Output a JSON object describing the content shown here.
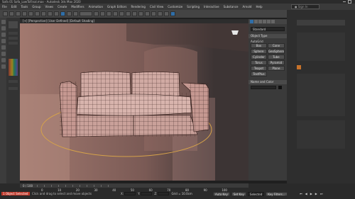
{
  "app": {
    "window_title": "Sofa 01 Sofa_LowToFinal.max - Autodesk 3ds Max 2020",
    "colors": {
      "viewport_bg": "#3a302f",
      "accent_blue": "#2f6ea8",
      "selection_ring": "#d5a24a",
      "key_red": "#c0392b"
    }
  },
  "menubar": {
    "items": [
      "File",
      "Edit",
      "Tools",
      "Group",
      "Views",
      "Create",
      "Modifiers",
      "Animation",
      "Graph Editors",
      "Rendering",
      "Civil View",
      "Customize",
      "Scripting",
      "Interactive",
      "Substance",
      "Arnold",
      "Help"
    ],
    "search_placeholder": "Sign In"
  },
  "toolbar": {
    "icons": [
      "undo-icon",
      "redo-icon",
      "link-icon",
      "unlink-icon",
      "bind-icon",
      "select-icon",
      "select-by-name-icon",
      "rect-selection-icon",
      "window-crossing-icon",
      "move-icon",
      "rotate-icon",
      "scale-icon",
      "reference-coord-icon",
      "pivot-icon",
      "snap-icon",
      "angle-snap-icon",
      "percent-snap-icon",
      "mirror-icon",
      "align-icon",
      "layer-icon",
      "curve-editor-icon",
      "schematic-icon",
      "material-editor-icon",
      "render-setup-icon",
      "render-frame-icon",
      "render-icon"
    ]
  },
  "viewport": {
    "label": "[+] [Perspective] [User Defined] [Default Shading]"
  },
  "command_panel": {
    "dropdown": "Standard",
    "rollout_object_type": "Object Type",
    "autogrid": "AutoGrid",
    "buttons": [
      "Box",
      "Cone",
      "Sphere",
      "GeoSphere",
      "Cylinder",
      "Tube",
      "Torus",
      "Pyramid",
      "Teapot",
      "Plane",
      "TextPlus"
    ],
    "rollout_name_color": "Name and Color"
  },
  "timeline": {
    "frame_counter": "0 / 100",
    "frame_ticks": [
      "0",
      "10",
      "20",
      "30",
      "40",
      "50",
      "60",
      "70",
      "80",
      "90",
      "100"
    ]
  },
  "statusbar": {
    "selection_info": "1 Object Selected",
    "prompt": "Click and drag to select and move objects",
    "x_label": "X:",
    "y_label": "Y:",
    "z_label": "Z:",
    "grid_label": "Grid = 10.0cm",
    "auto_key": "Auto Key",
    "set_key": "Set Key",
    "selected_dropdown": "Selected",
    "key_filters": "Key Filters..."
  }
}
